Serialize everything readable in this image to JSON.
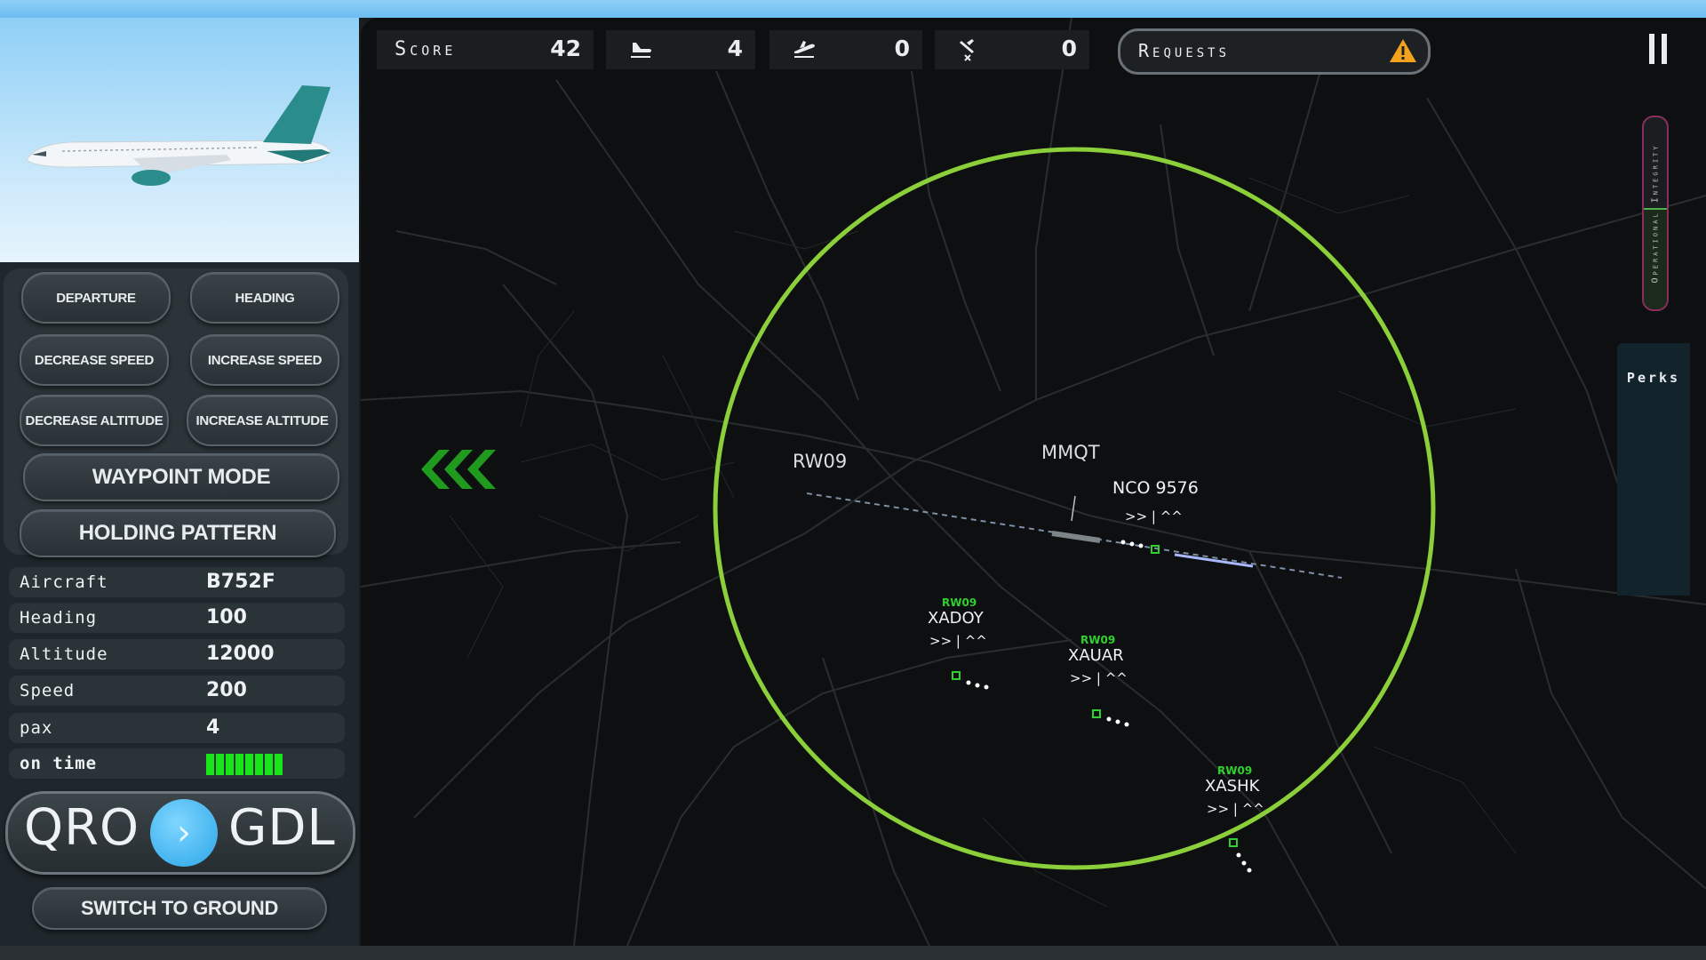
{
  "colors": {
    "radar_ring": "#8bd03a",
    "accent_green": "#19e619",
    "label_green": "#2fd12f",
    "panel_bg": "#1f272c"
  },
  "controls": {
    "departure": "Departure",
    "heading": "Heading",
    "decrease_speed": "Decrease Speed",
    "increase_speed": "Increase Speed",
    "decrease_altitude": "Decrease Altitude",
    "increase_altitude": "Increase Altitude",
    "waypoint_mode": "Waypoint Mode",
    "holding_pattern": "Holding Pattern",
    "switch_to_ground": "Switch to Ground"
  },
  "aircraft_info": {
    "aircraft_label": "Aircraft",
    "aircraft_value": "B752F",
    "heading_label": "Heading",
    "heading_value": "100",
    "altitude_label": "Altitude",
    "altitude_value": "12000",
    "speed_label": "Speed",
    "speed_value": "200",
    "pax_label": "pax",
    "pax_value": "4",
    "on_time_label": "on time",
    "on_time_level": 1.0
  },
  "route": {
    "origin": "QRO",
    "destination": "GDL",
    "arrow_icon": "chevron-right-icon"
  },
  "topbar": {
    "score_label": "Score",
    "score_value": "42",
    "landings_icon": "landing-plane-icon",
    "landings_value": "4",
    "departures_icon": "takeoff-plane-icon",
    "departures_value": "0",
    "crashes_icon": "crashed-plane-icon",
    "crashes_value": "0",
    "requests_label": "Requests",
    "requests_icon": "warning-icon",
    "pause_icon": "pause-icon"
  },
  "side": {
    "integrity_label": "Operational Integrity",
    "integrity_level": 0.52,
    "perks_label": "Perks"
  },
  "map": {
    "runway_label": "RW09",
    "fix_label": "MMQT",
    "collapse_icon": "triple-chevron-left-icon",
    "flights": [
      {
        "callsign": "NCO 9576",
        "runway": "",
        "symbols": ">> | ^^"
      },
      {
        "callsign": "XADOY",
        "runway": "RW09",
        "symbols": ">> | ^^"
      },
      {
        "callsign": "XAUAR",
        "runway": "RW09",
        "symbols": ">> | ^^"
      },
      {
        "callsign": "XASHK",
        "runway": "RW09",
        "symbols": ">> | ^^"
      }
    ]
  }
}
